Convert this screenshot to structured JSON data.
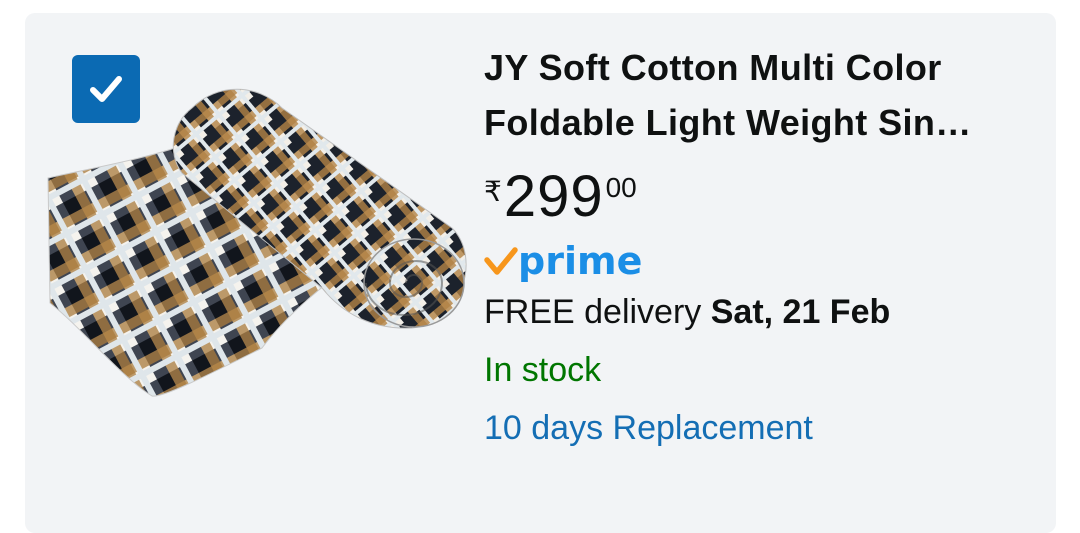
{
  "product": {
    "title_line1": "JY Soft Cotton Multi Color",
    "title_line2": "Foldable Light Weight Sin…",
    "price_currency": "₹",
    "price_whole": "299",
    "price_fraction": "00",
    "prime_label": "prime",
    "delivery_prefix": "FREE delivery ",
    "delivery_date": "Sat, 21 Feb",
    "stock_status": "In stock",
    "return_policy": "10 days Replacement",
    "selected": true
  },
  "icons": {
    "checkbox": "checkmark-icon",
    "prime": "prime-check-icon",
    "image": "rolled-checkered-mattress"
  },
  "colors": {
    "checkbox_bg": "#0b6ab3",
    "prime_blue": "#1b8ee6",
    "prime_orange": "#f7961c",
    "stock_green": "#007600",
    "link_blue": "#146eb4",
    "card_bg": "#f2f4f6"
  }
}
